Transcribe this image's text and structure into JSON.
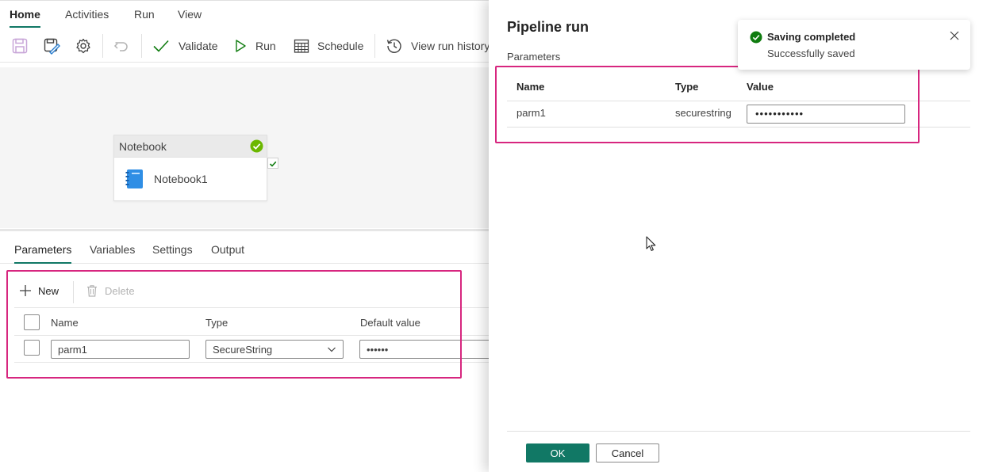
{
  "menu": {
    "tabs": [
      {
        "label": "Home",
        "active": true
      },
      {
        "label": "Activities"
      },
      {
        "label": "Run"
      },
      {
        "label": "View"
      }
    ]
  },
  "toolbar": {
    "validate_label": "Validate",
    "run_label": "Run",
    "schedule_label": "Schedule",
    "history_label": "View run history"
  },
  "canvas": {
    "activity_type": "Notebook",
    "activity_name": "Notebook1"
  },
  "bottom": {
    "tabs": [
      {
        "label": "Parameters",
        "active": true
      },
      {
        "label": "Variables"
      },
      {
        "label": "Settings"
      },
      {
        "label": "Output"
      }
    ],
    "new_label": "New",
    "delete_label": "Delete",
    "columns": [
      "Name",
      "Type",
      "Default value"
    ],
    "rows": [
      {
        "name": "parm1",
        "type": "SecureString",
        "default_value": "••••••"
      }
    ]
  },
  "panel": {
    "title": "Pipeline run",
    "section_label": "Parameters",
    "columns": [
      "Name",
      "Type",
      "Value"
    ],
    "rows": [
      {
        "name": "parm1",
        "type": "securestring",
        "value": "•••••••••••"
      }
    ],
    "ok_label": "OK",
    "cancel_label": "Cancel"
  },
  "toast": {
    "title": "Saving completed",
    "message": "Successfully saved"
  },
  "colors": {
    "accent": "#117865",
    "success": "#107c10",
    "highlight": "#d7267f"
  }
}
